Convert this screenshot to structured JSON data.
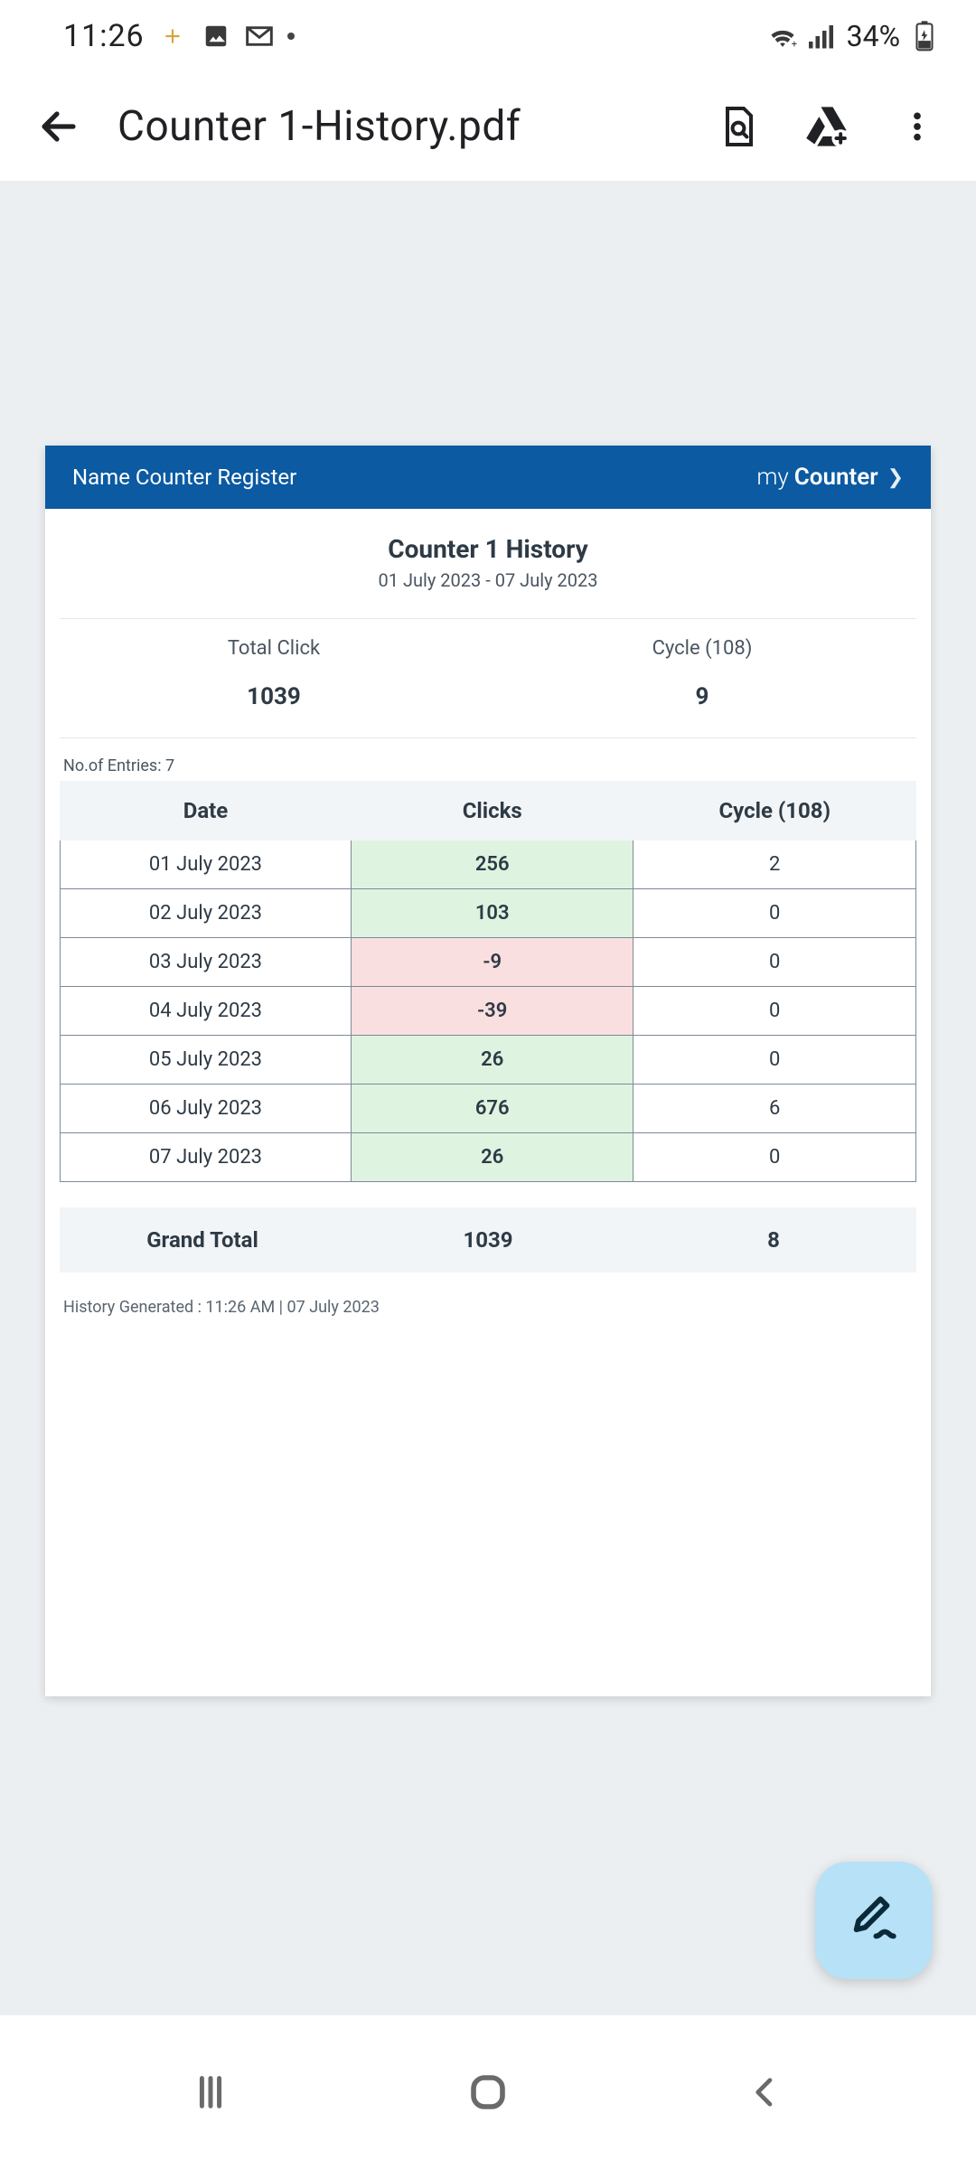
{
  "status": {
    "time": "11:26",
    "battery_text": "34%"
  },
  "appbar": {
    "title": "Counter 1-History.pdf"
  },
  "pdf": {
    "header_left": "Name Counter Register",
    "brand_thin": "my",
    "brand_bold": "Counter",
    "title": "Counter 1 History",
    "date_range": "01 July 2023 - 07 July 2023",
    "summary": {
      "total_click_label": "Total Click",
      "total_click_value": "1039",
      "cycle_label": "Cycle (108)",
      "cycle_value": "9"
    },
    "entries_note": "No.of Entries: 7",
    "columns": {
      "date": "Date",
      "clicks": "Clicks",
      "cycle": "Cycle (108)"
    },
    "rows": [
      {
        "date": "01 July 2023",
        "clicks": "256",
        "cycle": "2",
        "sign": "pos"
      },
      {
        "date": "02 July 2023",
        "clicks": "103",
        "cycle": "0",
        "sign": "pos"
      },
      {
        "date": "03 July 2023",
        "clicks": "-9",
        "cycle": "0",
        "sign": "neg"
      },
      {
        "date": "04 July 2023",
        "clicks": "-39",
        "cycle": "0",
        "sign": "neg"
      },
      {
        "date": "05 July 2023",
        "clicks": "26",
        "cycle": "0",
        "sign": "pos"
      },
      {
        "date": "06 July 2023",
        "clicks": "676",
        "cycle": "6",
        "sign": "pos"
      },
      {
        "date": "07 July 2023",
        "clicks": "26",
        "cycle": "0",
        "sign": "pos"
      }
    ],
    "grand": {
      "label": "Grand Total",
      "clicks": "1039",
      "cycle": "8"
    },
    "generated_note": "History Generated : 11:26 AM | 07 July 2023"
  }
}
